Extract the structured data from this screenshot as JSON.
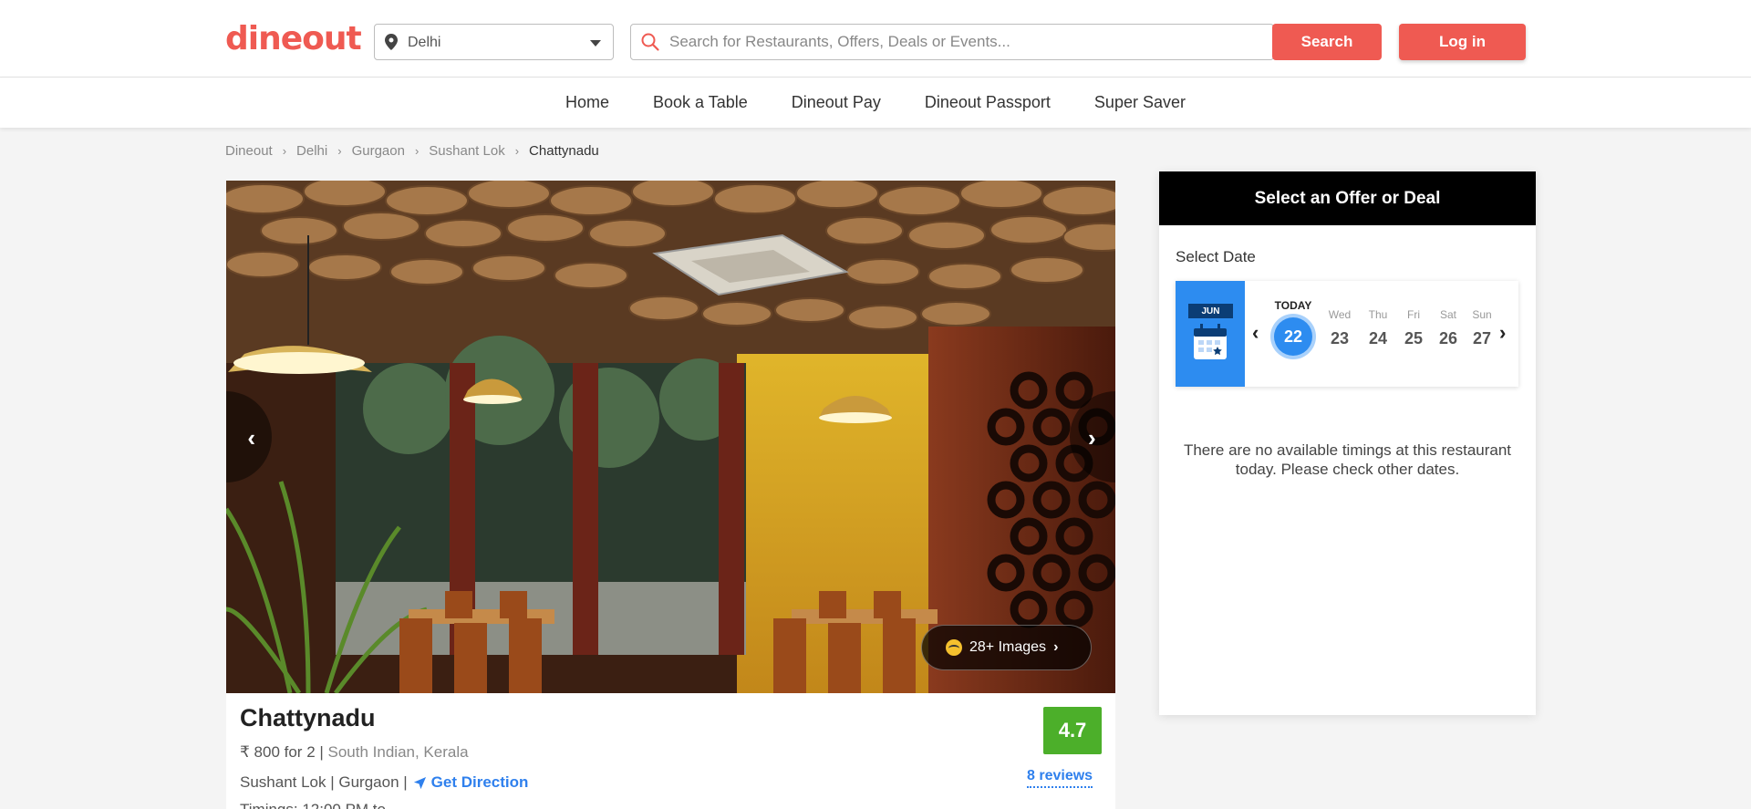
{
  "header": {
    "logo": "dineout",
    "location": "Delhi",
    "search_placeholder": "Search for Restaurants, Offers, Deals or Events...",
    "search_button": "Search",
    "login_button": "Log in"
  },
  "nav": {
    "items": [
      "Home",
      "Book a Table",
      "Dineout Pay",
      "Dineout Passport",
      "Super Saver"
    ]
  },
  "breadcrumb": [
    "Dineout",
    "Delhi",
    "Gurgaon",
    "Sushant Lok",
    "Chattynadu"
  ],
  "gallery": {
    "images_label": "28+ Images"
  },
  "restaurant": {
    "name": "Chattynadu",
    "cost": "₹ 800 for 2 | ",
    "cuisines": "South Indian, Kerala",
    "address": "Sushant Lok | Gurgaon | ",
    "direction_label": "Get Direction",
    "timing_partial": "Timings: 12:00 PM to ...",
    "rating": "4.7",
    "reviews": "8 reviews",
    "rating_color": "#4caf2a"
  },
  "booking": {
    "title": "Select an Offer or Deal",
    "select_date_label": "Select Date",
    "month": "JUN",
    "days": [
      {
        "name": "TODAY",
        "num": "22"
      },
      {
        "name": "Wed",
        "num": "23"
      },
      {
        "name": "Thu",
        "num": "24"
      },
      {
        "name": "Fri",
        "num": "25"
      },
      {
        "name": "Sat",
        "num": "26"
      },
      {
        "name": "Sun",
        "num": "27"
      }
    ],
    "no_timing_message": "There are no available timings at this restaurant today. Please check other dates."
  },
  "colors": {
    "brand": "#ef5a52",
    "accent_blue": "#2d8cf0"
  }
}
